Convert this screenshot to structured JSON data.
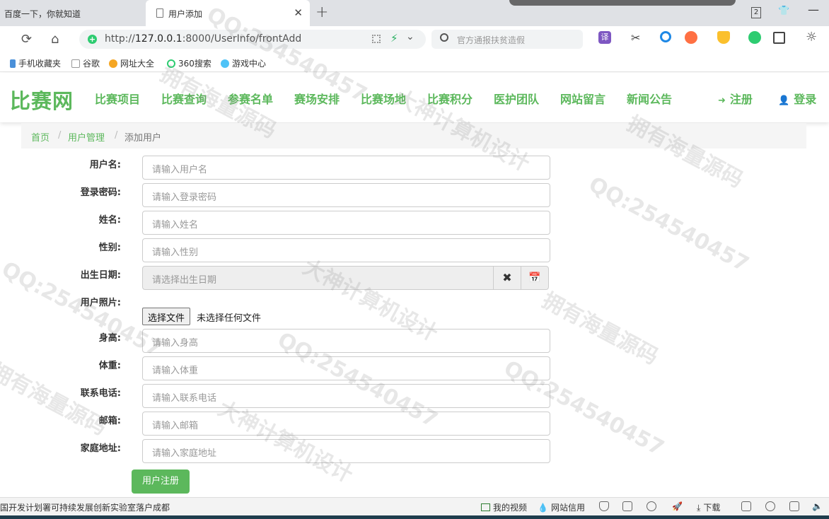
{
  "browser": {
    "tab1_title": "百度一下，你就知道",
    "tab2_title": "用户添加",
    "tab_close": "✕",
    "new_tab": "+",
    "tab_count": "2",
    "url_prefix": "http://",
    "url_host": "127.0.0.1",
    "url_rest": ":8000/UserInfo/frontAdd",
    "search_placeholder": "官方通报扶贫造假",
    "translate_label": "译"
  },
  "bookmarks": [
    {
      "label": "手机收藏夹",
      "color": "#4a90d9"
    },
    {
      "label": "谷歌",
      "color": "#bbbbbb"
    },
    {
      "label": "网址大全",
      "color": "#f5a623"
    },
    {
      "label": "360搜索",
      "color": "#2ecc71"
    },
    {
      "label": "游戏中心",
      "color": "#4fc3f7"
    }
  ],
  "site": {
    "logo": "比赛网",
    "menu": [
      "比赛项目",
      "比赛查询",
      "参赛名单",
      "赛场安排",
      "比赛场地",
      "比赛积分",
      "医护团队",
      "网站留言",
      "新闻公告"
    ],
    "register": "注册",
    "login": "登录",
    "accent_color": "#5cb85c"
  },
  "breadcrumb": {
    "home": "首页",
    "section": "用户管理",
    "current": "添加用户",
    "sep": "/"
  },
  "form": {
    "username": {
      "label": "用户名:",
      "placeholder": "请输入用户名"
    },
    "password": {
      "label": "登录密码:",
      "placeholder": "请输入登录密码"
    },
    "name": {
      "label": "姓名:",
      "placeholder": "请输入姓名"
    },
    "gender": {
      "label": "性别:",
      "placeholder": "请输入性别"
    },
    "birthday": {
      "label": "出生日期:",
      "placeholder": "请选择出生日期",
      "clear_icon": "✖",
      "calendar_icon": "📅"
    },
    "photo": {
      "label": "用户照片:",
      "button": "选择文件",
      "status": "未选择任何文件"
    },
    "height": {
      "label": "身高:",
      "placeholder": "请输入身高"
    },
    "weight": {
      "label": "体重:",
      "placeholder": "请输入体重"
    },
    "phone": {
      "label": "联系电话:",
      "placeholder": "请输入联系电话"
    },
    "email": {
      "label": "邮箱:",
      "placeholder": "请输入邮箱"
    },
    "address": {
      "label": "家庭地址:",
      "placeholder": "请输入家庭地址"
    },
    "submit": "用户注册"
  },
  "statusbar": {
    "left_text": "国开发计划署可持续发展创新实验室落户成都",
    "video": "我的视频",
    "credit": "网站信用",
    "download": "下载"
  },
  "watermarks": [
    "QQ:254540457",
    "拥有海量源码",
    "大神计算机设计"
  ]
}
